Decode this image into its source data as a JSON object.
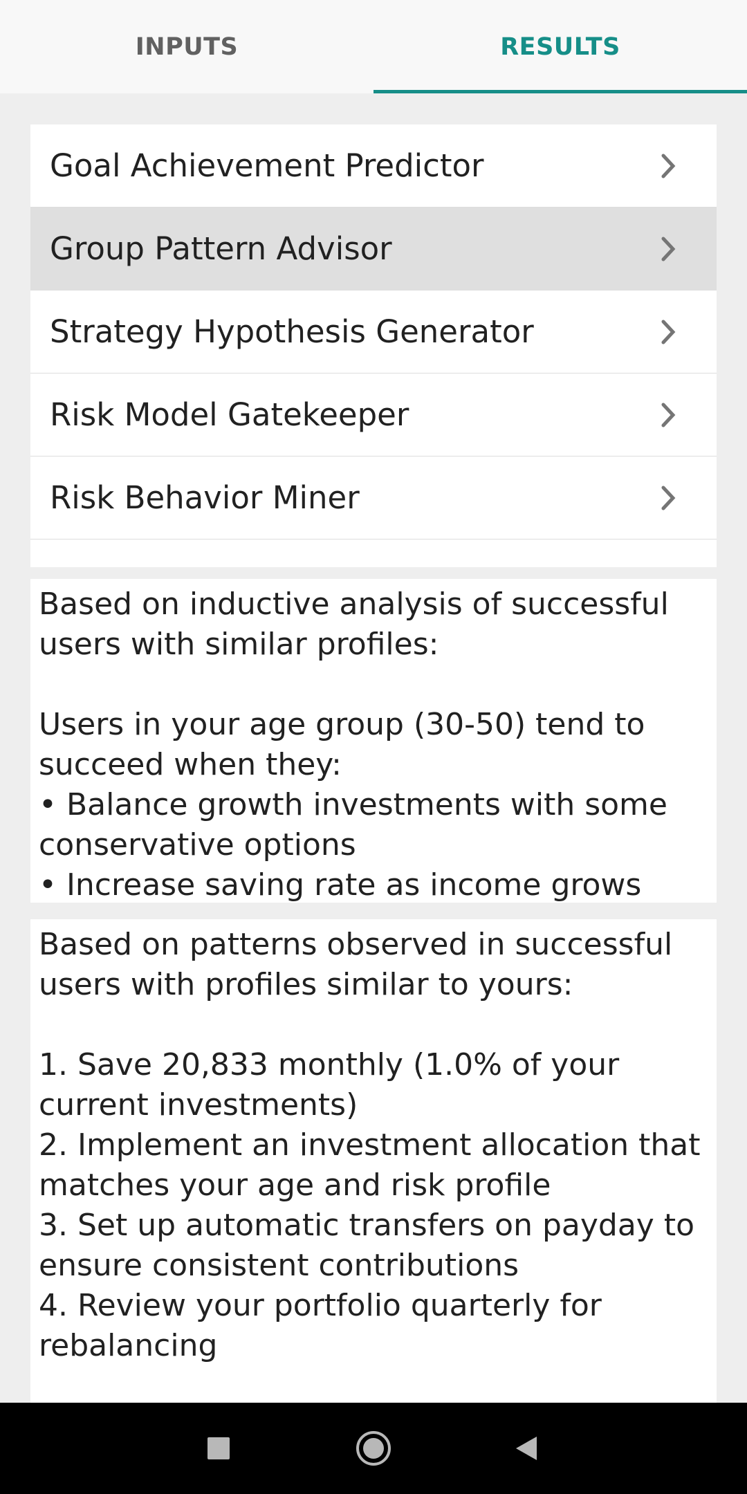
{
  "tabs": [
    {
      "label": "INPUTS",
      "active": false
    },
    {
      "label": "RESULTS",
      "active": true
    }
  ],
  "accent_color": "#168e88",
  "menu": {
    "items": [
      {
        "label": "Goal Achievement Predictor",
        "icon": "chevron-right-icon"
      },
      {
        "label": "Group Pattern Advisor",
        "icon": "chevron-right-icon",
        "highlighted": true
      },
      {
        "label": "Strategy Hypothesis Generator",
        "icon": "chevron-right-icon"
      },
      {
        "label": "Risk Model Gatekeeper",
        "icon": "chevron-right-icon"
      },
      {
        "label": "Risk Behavior Miner",
        "icon": "chevron-right-icon"
      }
    ]
  },
  "cards": [
    {
      "text": "Based on inductive analysis of successful users with similar profiles:\n\nUsers in your age group (30-50) tend to succeed when they:\n• Balance growth investments with some conservative options\n• Increase saving rate as income grows"
    },
    {
      "text": "Based on patterns observed in successful users with profiles similar to yours:\n\n1. Save 20,833 monthly (1.0% of your current investments)\n2. Implement an investment allocation that matches your age and risk profile\n3. Set up automatic transfers on payday to ensure consistent contributions\n4. Review your portfolio quarterly for rebalancing"
    }
  ],
  "navbar": {
    "buttons": [
      "recents-square-icon",
      "home-circle-icon",
      "back-triangle-icon"
    ]
  }
}
